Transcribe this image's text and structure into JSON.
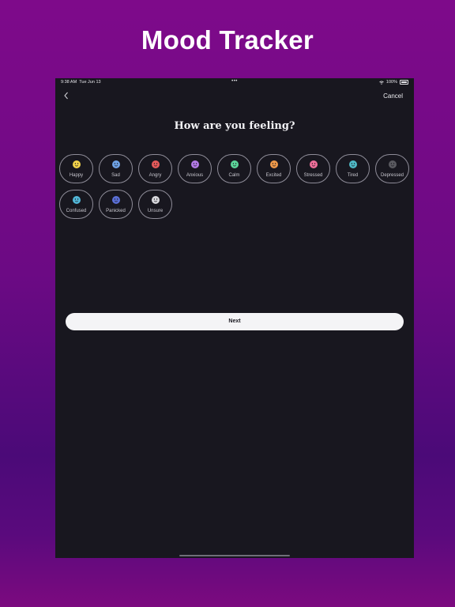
{
  "promo": {
    "title": "Mood Tracker"
  },
  "status_bar": {
    "time": "9:38 AM",
    "date": "Tue Jun 13",
    "center_dots": "•••",
    "battery": "100%"
  },
  "nav": {
    "cancel_label": "Cancel",
    "back_icon": "chevron-left-icon"
  },
  "question": "How are you feeling?",
  "moods": [
    {
      "label": "Happy",
      "color": "#f2d24a"
    },
    {
      "label": "Sad",
      "color": "#6fa3e6"
    },
    {
      "label": "Angry",
      "color": "#e55a5a"
    },
    {
      "label": "Anxious",
      "color": "#b27ae6"
    },
    {
      "label": "Calm",
      "color": "#5cd69a"
    },
    {
      "label": "Excited",
      "color": "#f09a4a"
    },
    {
      "label": "Stressed",
      "color": "#ef6f9a"
    },
    {
      "label": "Tired",
      "color": "#4fb9c6"
    },
    {
      "label": "Depressed",
      "color": "#5a5a60"
    },
    {
      "label": "Confused",
      "color": "#52b7d8"
    },
    {
      "label": "Panicked",
      "color": "#5a6fd6"
    },
    {
      "label": "Unsure",
      "color": "#d8d8dc"
    }
  ],
  "next_label": "Next"
}
